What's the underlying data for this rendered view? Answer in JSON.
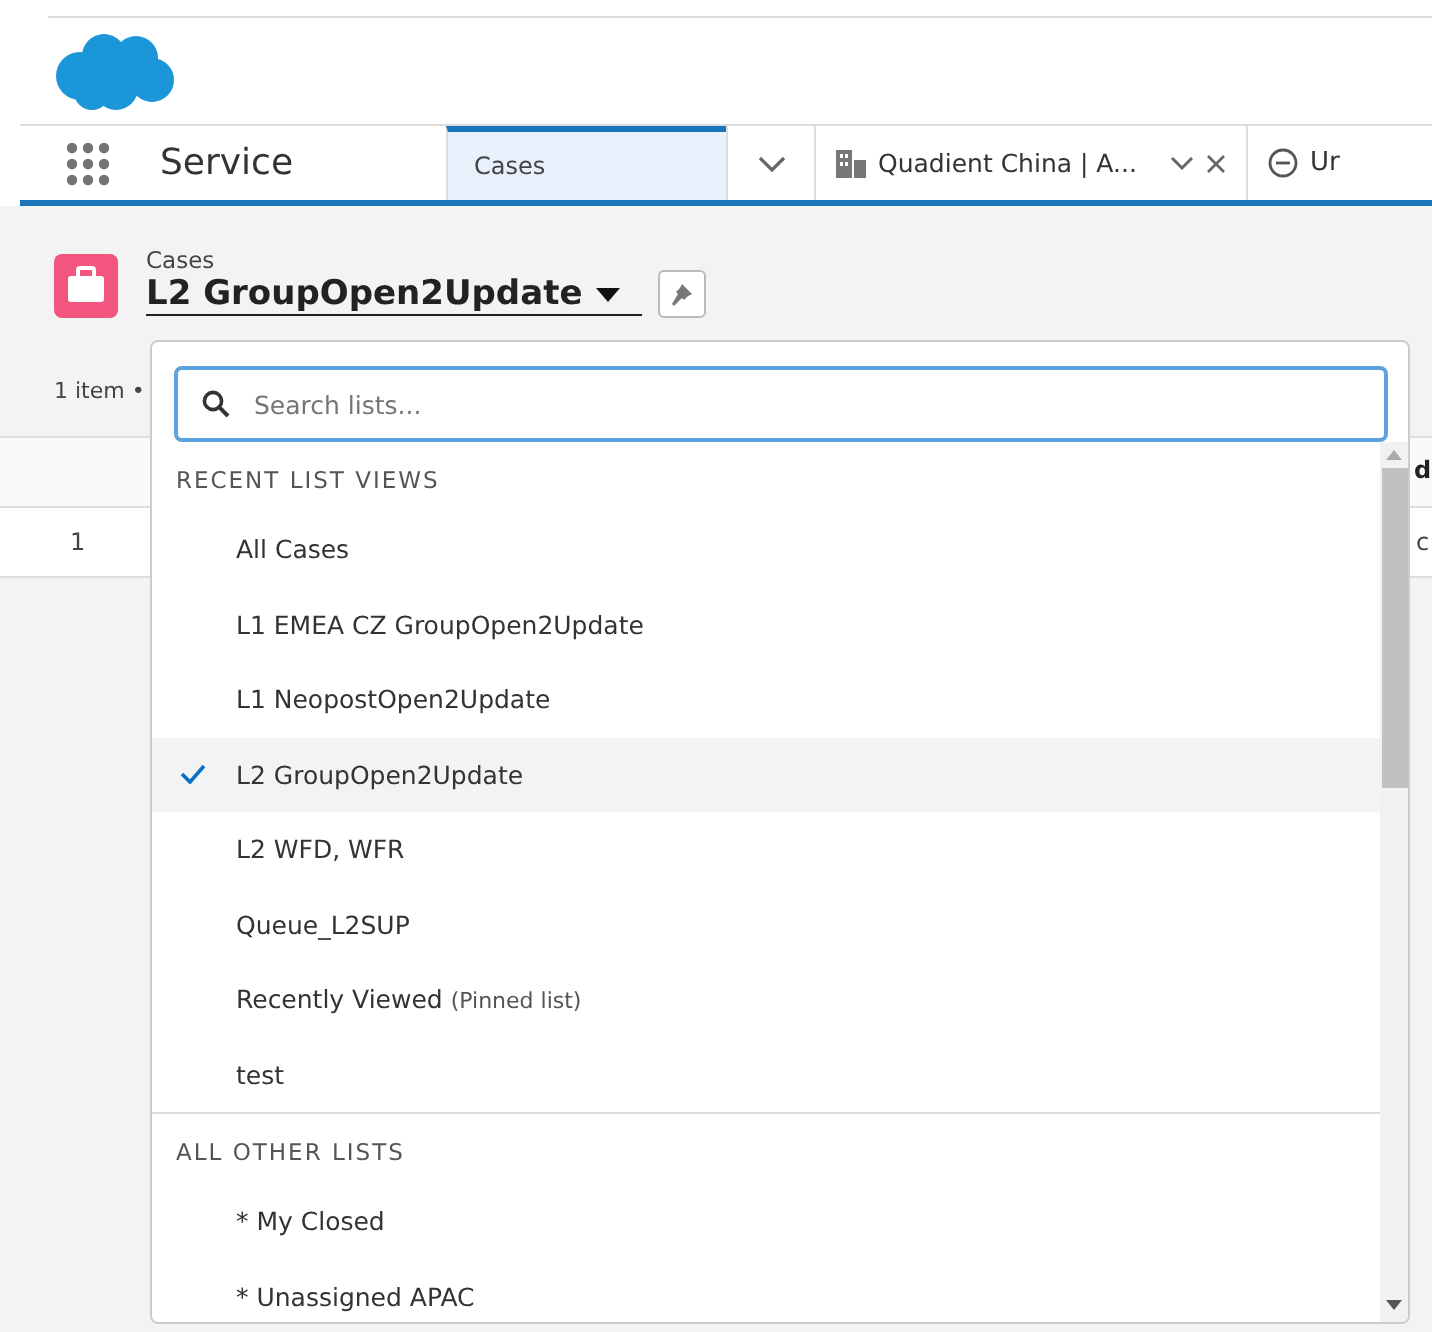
{
  "app_name": "Service",
  "nav_tabs": [
    {
      "label": "Cases",
      "kind": "object",
      "selected": true
    },
    {
      "label": "Quadient China | A...",
      "kind": "record",
      "selected": false
    },
    {
      "label": "Ur",
      "kind": "cut",
      "selected": false
    }
  ],
  "list_header": {
    "object": "Cases",
    "list_name": "L2 GroupOpen2Update"
  },
  "table": {
    "count_text": "1 item •",
    "column_2": "d",
    "rows": [
      {
        "number": "1",
        "column_2": "c"
      }
    ]
  },
  "dropdown": {
    "search": {
      "placeholder": "Search lists..."
    },
    "sections": [
      {
        "heading": "RECENT LIST VIEWS",
        "items": [
          {
            "label": "All Cases",
            "selected": false
          },
          {
            "label": "L1 EMEA CZ GroupOpen2Update",
            "selected": false
          },
          {
            "label": "L1 NeopostOpen2Update",
            "selected": false
          },
          {
            "label": "L2 GroupOpen2Update",
            "selected": true
          },
          {
            "label": "L2 WFD, WFR",
            "selected": false
          },
          {
            "label": "Queue_L2SUP",
            "selected": false
          },
          {
            "label": "Recently Viewed",
            "note": "(Pinned list)",
            "selected": false
          },
          {
            "label": "test",
            "selected": false
          }
        ]
      },
      {
        "heading": "ALL OTHER LISTS",
        "items": [
          {
            "label": "* My Closed",
            "selected": false
          },
          {
            "label": "* Unassigned APAC",
            "selected": false
          }
        ]
      }
    ]
  }
}
